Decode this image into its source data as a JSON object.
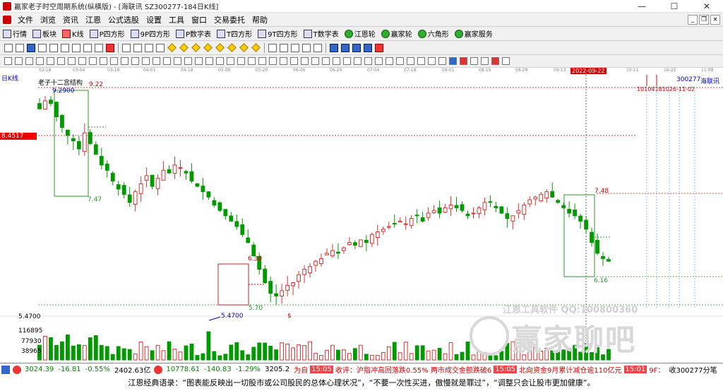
{
  "window": {
    "title": "赢家老子时空周期系统(纵横版) - [海联讯  SZ300277-184日K线]",
    "controls": [
      "—",
      "☐",
      "✕"
    ]
  },
  "menu": [
    "文件",
    "浏览",
    "资讯",
    "江恩",
    "公式选股",
    "设置",
    "工具",
    "窗口",
    "交易委托",
    "帮助"
  ],
  "toolbar": [
    "行情",
    "板块",
    "K线",
    "P四方形",
    "9P四方形",
    "P数字表",
    "T四方形",
    "9T四方形",
    "T数字表",
    "江恩轮",
    "赢家轮",
    "六角形",
    "赢家服务"
  ],
  "date_axis": {
    "ticks": [
      "02-18",
      "03-04",
      "03-18",
      "04-01",
      "04-19",
      "05-06",
      "05-20",
      "06-06",
      "06-20",
      "07-04",
      "07-18",
      "08-01",
      "08-15",
      "08-29",
      "09-13",
      "10-11",
      "10-25",
      "11-08"
    ],
    "highlight": "2022-09-22"
  },
  "chart": {
    "period_label": "日K线",
    "structure_label": "老子十二宫结构",
    "stock_code": "300277",
    "stock_name": "海联讯",
    "left_price_tag": "8.4517",
    "date_marks": "10104181026-11-02",
    "labels": {
      "top_high": "9.2900",
      "box1_top": "9.22",
      "box1_bottom": "7.47",
      "box2_top": "6.39",
      "box2_bottom": "5.70",
      "low": "5.4700",
      "box3_top": "7.48",
      "box3_bottom": "6.16",
      "dollar": "$"
    },
    "price_axis_low": "5.4700",
    "volume_ticks": [
      "116895",
      "77930",
      "38965"
    ]
  },
  "watermark": {
    "qq": "江恩工具软件  QQ:100800360",
    "logo_text": "赢家聊吧"
  },
  "statusbar": {
    "sh_index": "3024.39",
    "sh_change": "-16.81",
    "sh_pct": "-0.55%",
    "sh_amount": "2402.63亿",
    "sz_index": "10778.61",
    "sz_change": "-140.83",
    "sz_pct": "-1.29%",
    "sz_amount": "3205.2",
    "news_tag1": "为自",
    "time1": "15:05",
    "news1": "收评：沪指冲高回落跌0.55% 两市成交金额跌破6",
    "time2": "15:05",
    "news2": "北向资金9月累计减仓逾110亿元",
    "time3": "15:01",
    "news3": "9F：",
    "right_text": "收300277分笔"
  },
  "quote": "江恩经典语录：“图表能反映出一切股市或公司股民的总体心理状况”，“不要一次性买进，傲慢就是罪过”，“调整只会让股市更加健康”。",
  "colors": {
    "up": "#e03030",
    "down": "#009900",
    "box_green": "#2a9a2a",
    "box_red": "#d02020",
    "highlight": "#d00000"
  },
  "chart_data": {
    "type": "candlestick",
    "title": "",
    "x_start": "2022-02-18",
    "x_end": "2022-09-30",
    "ylim": [
      5.2,
      9.5
    ],
    "prices": [
      9.05,
      9.2,
      9.15,
      8.9,
      8.7,
      8.55,
      8.45,
      8.3,
      8.6,
      8.4,
      8.2,
      8.0,
      7.9,
      7.7,
      7.55,
      7.45,
      7.3,
      7.5,
      7.65,
      7.8,
      7.6,
      7.75,
      7.9,
      7.85,
      8.0,
      7.95,
      7.85,
      7.7,
      7.6,
      7.5,
      7.4,
      7.25,
      7.15,
      7.05,
      6.95,
      6.85,
      6.7,
      6.55,
      6.3,
      6.05,
      5.8,
      5.6,
      5.55,
      5.65,
      5.75,
      5.8,
      5.95,
      6.05,
      6.1,
      6.2,
      6.25,
      6.35,
      6.4,
      6.35,
      6.45,
      6.55,
      6.5,
      6.6,
      6.55,
      6.7,
      6.75,
      6.8,
      6.85,
      6.9,
      6.95,
      6.9,
      7.0,
      7.05,
      6.95,
      7.1,
      7.15,
      7.1,
      7.2,
      7.25,
      7.2,
      7.15,
      7.05,
      7.1,
      7.2,
      7.3,
      7.3,
      7.2,
      7.1,
      7.0,
      7.05,
      7.15,
      7.25,
      7.35,
      7.4,
      7.45,
      7.5,
      7.4,
      7.3,
      7.2,
      7.1,
      7.05,
      6.95,
      6.8,
      6.55,
      6.35,
      6.25,
      6.2
    ]
  }
}
